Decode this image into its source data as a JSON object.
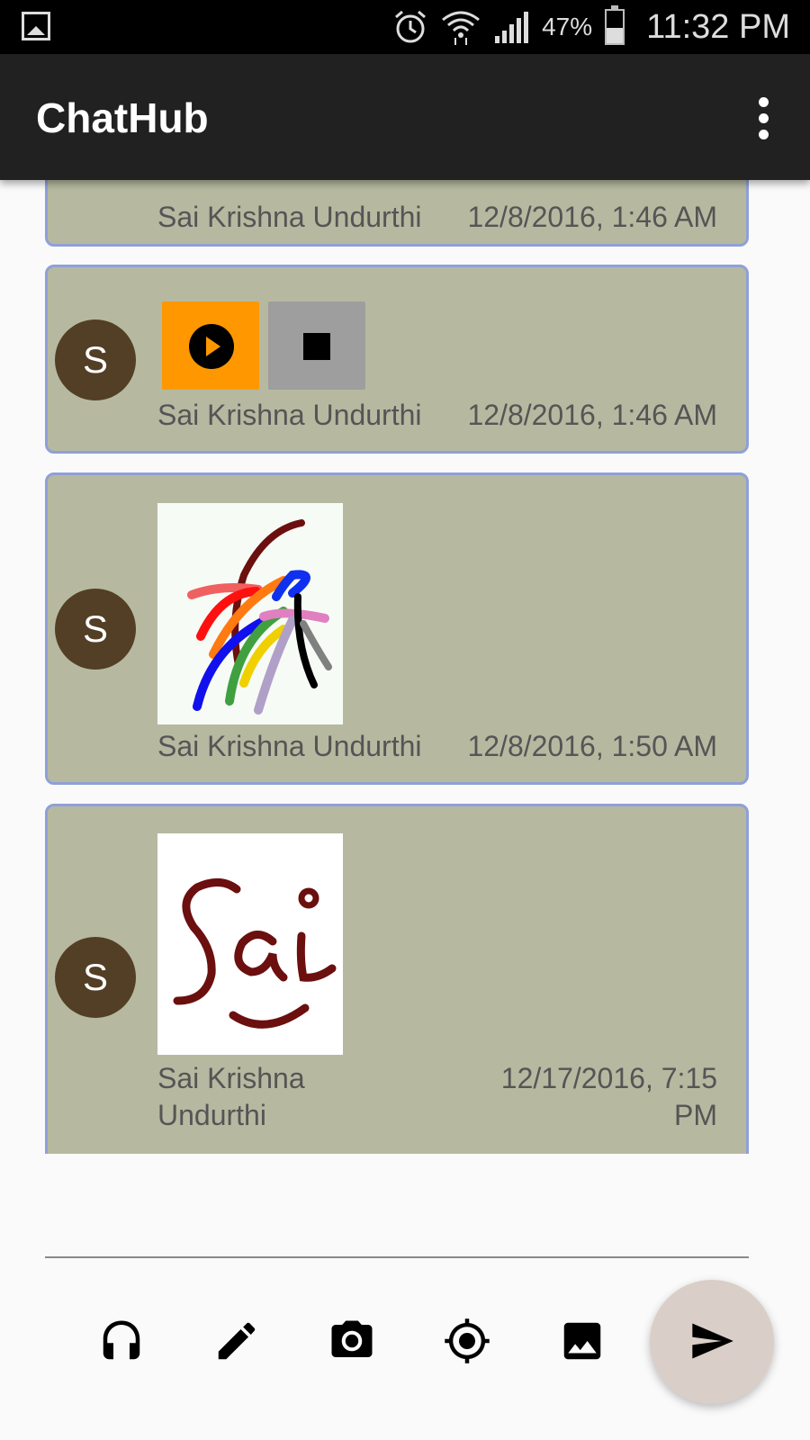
{
  "status_bar": {
    "battery_percent": "47%",
    "battery_level": 0.47,
    "time": "11:32 PM",
    "icons": [
      "gallery-icon",
      "alarm-icon",
      "wifi-icon",
      "signal-icon",
      "battery-icon"
    ]
  },
  "app_bar": {
    "title": "ChatHub",
    "menu_icon": "more-vert-icon"
  },
  "messages": [
    {
      "type": "partial",
      "sender": "Sai Krishna Undurthi",
      "timestamp": "12/8/2016, 1:46 AM"
    },
    {
      "type": "audio",
      "avatar_letter": "S",
      "sender": "Sai Krishna Undurthi",
      "timestamp": "12/8/2016, 1:46 AM",
      "controls": [
        "play-icon",
        "stop-icon"
      ]
    },
    {
      "type": "image",
      "avatar_letter": "S",
      "sender": "Sai Krishna Undurthi",
      "timestamp": "12/8/2016, 1:50 AM",
      "image": "colorful-sketch"
    },
    {
      "type": "image",
      "avatar_letter": "S",
      "sender_line1": "Sai Krishna",
      "sender_line2": "Undurthi",
      "timestamp_line1": "12/17/2016, 7:15",
      "timestamp_line2": "PM",
      "image": "handwritten-sai"
    }
  ],
  "composer": {
    "value": "",
    "placeholder": ""
  },
  "toolbar": {
    "icons": [
      "headset-icon",
      "pencil-icon",
      "camera-icon",
      "location-icon",
      "image-icon"
    ],
    "send_icon": "send-icon"
  },
  "colors": {
    "app_bar": "#212121",
    "bubble_bg": "#b6b9a0",
    "bubble_border": "#8fa0d8",
    "avatar": "#533f25",
    "play_button": "#ff9800",
    "stop_button": "#9e9e9e",
    "send_fab": "#d9cfc8"
  }
}
